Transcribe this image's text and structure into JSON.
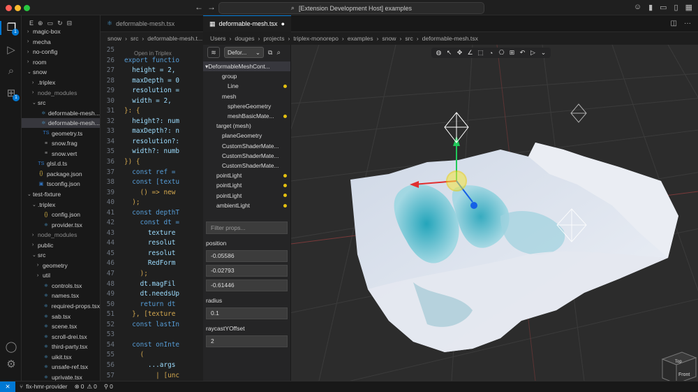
{
  "window": {
    "title": "[Extension Development Host] examples"
  },
  "explorer": {
    "items": [
      {
        "label": "magic-box",
        "depth": 0,
        "kind": "folder",
        "open": false
      },
      {
        "label": "mecha",
        "depth": 0,
        "kind": "folder",
        "open": false
      },
      {
        "label": "no-config",
        "depth": 0,
        "kind": "folder",
        "open": false
      },
      {
        "label": "room",
        "depth": 0,
        "kind": "folder",
        "open": false
      },
      {
        "label": "snow",
        "depth": 0,
        "kind": "folder",
        "open": true
      },
      {
        "label": ".triplex",
        "depth": 1,
        "kind": "folder",
        "open": false
      },
      {
        "label": "node_modules",
        "depth": 1,
        "kind": "folder",
        "open": false,
        "dim": true
      },
      {
        "label": "src",
        "depth": 1,
        "kind": "folder",
        "open": true
      },
      {
        "label": "deformable-mesh...",
        "depth": 2,
        "kind": "tsx"
      },
      {
        "label": "deformable-mesh...",
        "depth": 2,
        "kind": "tsx",
        "selected": true
      },
      {
        "label": "geometry.ts",
        "depth": 2,
        "kind": "ts"
      },
      {
        "label": "snow.frag",
        "depth": 2,
        "kind": "file"
      },
      {
        "label": "snow.vert",
        "depth": 2,
        "kind": "file"
      },
      {
        "label": "glsl.d.ts",
        "depth": 1,
        "kind": "ts"
      },
      {
        "label": "package.json",
        "depth": 1,
        "kind": "json"
      },
      {
        "label": "tsconfig.json",
        "depth": 1,
        "kind": "tsconfig"
      },
      {
        "label": "test-fixture",
        "depth": 0,
        "kind": "folder",
        "open": true
      },
      {
        "label": ".triplex",
        "depth": 1,
        "kind": "folder",
        "open": true
      },
      {
        "label": "config.json",
        "depth": 2,
        "kind": "json"
      },
      {
        "label": "provider.tsx",
        "depth": 2,
        "kind": "tsx"
      },
      {
        "label": "node_modules",
        "depth": 1,
        "kind": "folder",
        "open": false,
        "dim": true
      },
      {
        "label": "public",
        "depth": 1,
        "kind": "folder",
        "open": false
      },
      {
        "label": "src",
        "depth": 1,
        "kind": "folder",
        "open": true
      },
      {
        "label": "geometry",
        "depth": 2,
        "kind": "folder",
        "open": false
      },
      {
        "label": "util",
        "depth": 2,
        "kind": "folder",
        "open": false
      },
      {
        "label": "controls.tsx",
        "depth": 2,
        "kind": "tsx"
      },
      {
        "label": "names.tsx",
        "depth": 2,
        "kind": "tsx"
      },
      {
        "label": "required-props.tsx",
        "depth": 2,
        "kind": "tsx"
      },
      {
        "label": "sab.tsx",
        "depth": 2,
        "kind": "tsx"
      },
      {
        "label": "scene.tsx",
        "depth": 2,
        "kind": "tsx"
      },
      {
        "label": "scroll-drei.tsx",
        "depth": 2,
        "kind": "tsx"
      },
      {
        "label": "third-party.tsx",
        "depth": 2,
        "kind": "tsx"
      },
      {
        "label": "uikit.tsx",
        "depth": 2,
        "kind": "tsx"
      },
      {
        "label": "unsafe-ref.tsx",
        "depth": 2,
        "kind": "tsx"
      },
      {
        "label": "uprivate.tsx",
        "depth": 2,
        "kind": "tsx"
      }
    ]
  },
  "editor": {
    "tab_label": "deformable-mesh.tsx",
    "breadcrumbs": [
      "snow",
      "src",
      "deformable-mesh.t..."
    ],
    "hint": "Open in Triplex",
    "lines": [
      {
        "n": "25",
        "t": ""
      },
      {
        "n": "26",
        "t": "export functio"
      },
      {
        "n": "27",
        "t": "  height = 2,"
      },
      {
        "n": "28",
        "t": "  maxDepth = 0"
      },
      {
        "n": "29",
        "t": "  resolution ="
      },
      {
        "n": "30",
        "t": "  width = 2,"
      },
      {
        "n": "31",
        "t": "}: {"
      },
      {
        "n": "32",
        "t": "  height?: num"
      },
      {
        "n": "33",
        "t": "  maxDepth?: n"
      },
      {
        "n": "34",
        "t": "  resolution?:"
      },
      {
        "n": "35",
        "t": "  width?: numb"
      },
      {
        "n": "36",
        "t": "}) {"
      },
      {
        "n": "37",
        "t": "  const ref ="
      },
      {
        "n": "38",
        "t": "  const [textu"
      },
      {
        "n": "39",
        "t": "    () => new"
      },
      {
        "n": "40",
        "t": "  );"
      },
      {
        "n": "41",
        "t": "  const depthT"
      },
      {
        "n": "42",
        "t": "    const dt ="
      },
      {
        "n": "43",
        "t": "      texture"
      },
      {
        "n": "44",
        "t": "      resolut"
      },
      {
        "n": "45",
        "t": "      resolut"
      },
      {
        "n": "46",
        "t": "      RedForm"
      },
      {
        "n": "47",
        "t": "    );"
      },
      {
        "n": "48",
        "t": "    dt.magFil"
      },
      {
        "n": "49",
        "t": "    dt.needsUp"
      },
      {
        "n": "50",
        "t": "    return dt"
      },
      {
        "n": "51",
        "t": "  }, [texture"
      },
      {
        "n": "52",
        "t": "  const lastIn"
      },
      {
        "n": "53",
        "t": ""
      },
      {
        "n": "54",
        "t": "  const onInte"
      },
      {
        "n": "55",
        "t": "    ("
      },
      {
        "n": "56",
        "t": "      ...args"
      },
      {
        "n": "57",
        "t": "        | [unc"
      },
      {
        "n": "58",
        "t": "        | [uv"
      }
    ]
  },
  "triplex": {
    "tab_label": "deformable-mesh.tsx",
    "breadcrumbs": [
      "Users",
      "douges",
      "projects",
      "triplex-monorepo",
      "examples",
      "snow",
      "src",
      "deformable-mesh.tsx"
    ],
    "component_select": "Defor...",
    "scene_tree": [
      {
        "label": "DeformableMeshCont...",
        "depth": 0,
        "selected": true,
        "arrow": true
      },
      {
        "label": "group",
        "depth": 1
      },
      {
        "label": "Line",
        "depth": 2,
        "dot": true
      },
      {
        "label": "mesh",
        "depth": 1
      },
      {
        "label": "sphereGeometry",
        "depth": 2
      },
      {
        "label": "meshBasicMate...",
        "depth": 2,
        "dot": true
      },
      {
        "label": "target (mesh)",
        "depth": 0
      },
      {
        "label": "planeGeometry",
        "depth": 1
      },
      {
        "label": "CustomShaderMate...",
        "depth": 1
      },
      {
        "label": "CustomShaderMate...",
        "depth": 1
      },
      {
        "label": "CustomShaderMate...",
        "depth": 1
      },
      {
        "label": "pointLight",
        "depth": 0,
        "dot": true
      },
      {
        "label": "pointLight",
        "depth": 0,
        "dot": true
      },
      {
        "label": "pointLight",
        "depth": 0,
        "dot": true
      },
      {
        "label": "ambientLight",
        "depth": 0,
        "dot": true
      }
    ],
    "filter_placeholder": "Filter props...",
    "props": {
      "position_label": "position",
      "position": [
        "-0.05586",
        "-0.02793",
        "-0.61446"
      ],
      "radius_label": "radius",
      "radius": "0.1",
      "raycast_label": "raycastYOffset",
      "raycast": "2"
    },
    "view_cube": {
      "top": "Top",
      "front": "Front"
    }
  },
  "status": {
    "branch": "fix-hmr-provider",
    "errors": "0",
    "warnings": "0",
    "ports": "0"
  }
}
